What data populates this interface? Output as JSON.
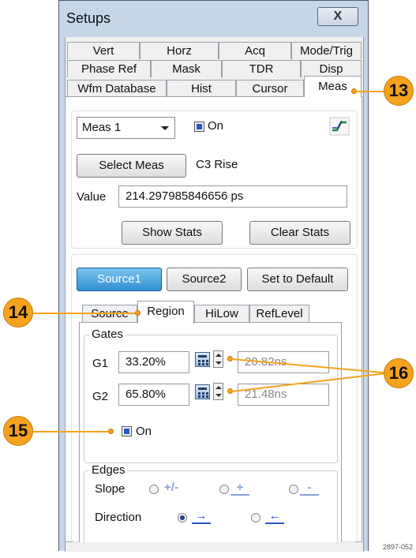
{
  "window": {
    "title": "Setups",
    "close_glyph": "X"
  },
  "tabs": {
    "row1": [
      "Vert",
      "Horz",
      "Acq",
      "Mode/Trig"
    ],
    "row2": [
      "Phase Ref",
      "Mask",
      "TDR",
      "Disp"
    ],
    "row3": [
      "Wfm Database",
      "Hist",
      "Cursor",
      "Meas"
    ],
    "active": "Meas"
  },
  "meas": {
    "selector_value": "Meas 1",
    "on_label": "On",
    "on_checked": true,
    "select_meas_label": "Select Meas",
    "selected_meas": "C3 Rise",
    "value_label": "Value",
    "value": "214.297985846656 ps",
    "show_stats_label": "Show Stats",
    "clear_stats_label": "Clear Stats",
    "icon": "rise-edge-icon"
  },
  "source_buttons": {
    "source1": "Source1",
    "source2": "Source2",
    "default": "Set to Default",
    "selected": "Source1"
  },
  "subtabs": [
    "Source",
    "Region",
    "HiLow",
    "RefLevel"
  ],
  "subtab_active": "Region",
  "gates": {
    "title": "Gates",
    "g1_label": "G1",
    "g1_value": "33.20%",
    "g1_time": "20.82ns",
    "g2_label": "G2",
    "g2_value": "65.80%",
    "g2_time": "21.48ns",
    "on_label": "On",
    "on_checked": true
  },
  "edges": {
    "title": "Edges",
    "slope_label": "Slope",
    "slope_options": [
      "+/-",
      "+",
      "-"
    ],
    "direction_label": "Direction",
    "direction_options": [
      "→",
      "←"
    ],
    "direction_selected": "→"
  },
  "callouts": [
    "13",
    "14",
    "15",
    "16"
  ],
  "figure_id": "2897-052",
  "colors": {
    "callout": "#f6a21e",
    "selected_button": "#2f8fd2",
    "window_frame": "#c7d6e7"
  }
}
